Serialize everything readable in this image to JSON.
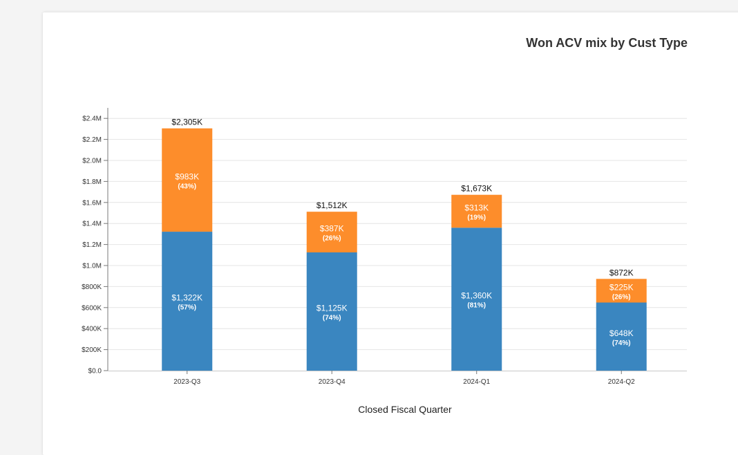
{
  "chart_data": {
    "type": "bar",
    "stacked": true,
    "title": "Won ACV mix by Cust Type",
    "xlabel": "Closed Fiscal Quarter",
    "ylabel": "",
    "categories": [
      "2023-Q3",
      "2023-Q4",
      "2024-Q1",
      "2024-Q2"
    ],
    "ylim": [
      0,
      2500000
    ],
    "yticks": [
      0,
      200000,
      400000,
      600000,
      800000,
      1000000,
      1200000,
      1400000,
      1600000,
      1800000,
      2000000,
      2200000,
      2400000
    ],
    "ytick_labels": [
      "$0.0",
      "$200K",
      "$400K",
      "$600K",
      "$800K",
      "$1.0M",
      "$1.2M",
      "$1.4M",
      "$1.6M",
      "$1.8M",
      "$2.0M",
      "$2.2M",
      "$2.4M"
    ],
    "grid": true,
    "legend": "none",
    "series": [
      {
        "color": "#3a86c0",
        "values": [
          1322000,
          1125000,
          1360000,
          648000
        ],
        "value_labels": [
          "$1,322K",
          "$1,125K",
          "$1,360K",
          "$648K"
        ],
        "pct_labels": [
          "(57%)",
          "(74%)",
          "(81%)",
          "(74%)"
        ]
      },
      {
        "color": "#fd8d2b",
        "values": [
          983000,
          387000,
          313000,
          225000
        ],
        "value_labels": [
          "$983K",
          "$387K",
          "$313K",
          "$225K"
        ],
        "pct_labels": [
          "(43%)",
          "(26%)",
          "(19%)",
          "(26%)"
        ]
      }
    ],
    "totals": [
      2305000,
      1512000,
      1673000,
      872000
    ],
    "total_labels": [
      "$2,305K",
      "$1,512K",
      "$1,673K",
      "$872K"
    ]
  }
}
